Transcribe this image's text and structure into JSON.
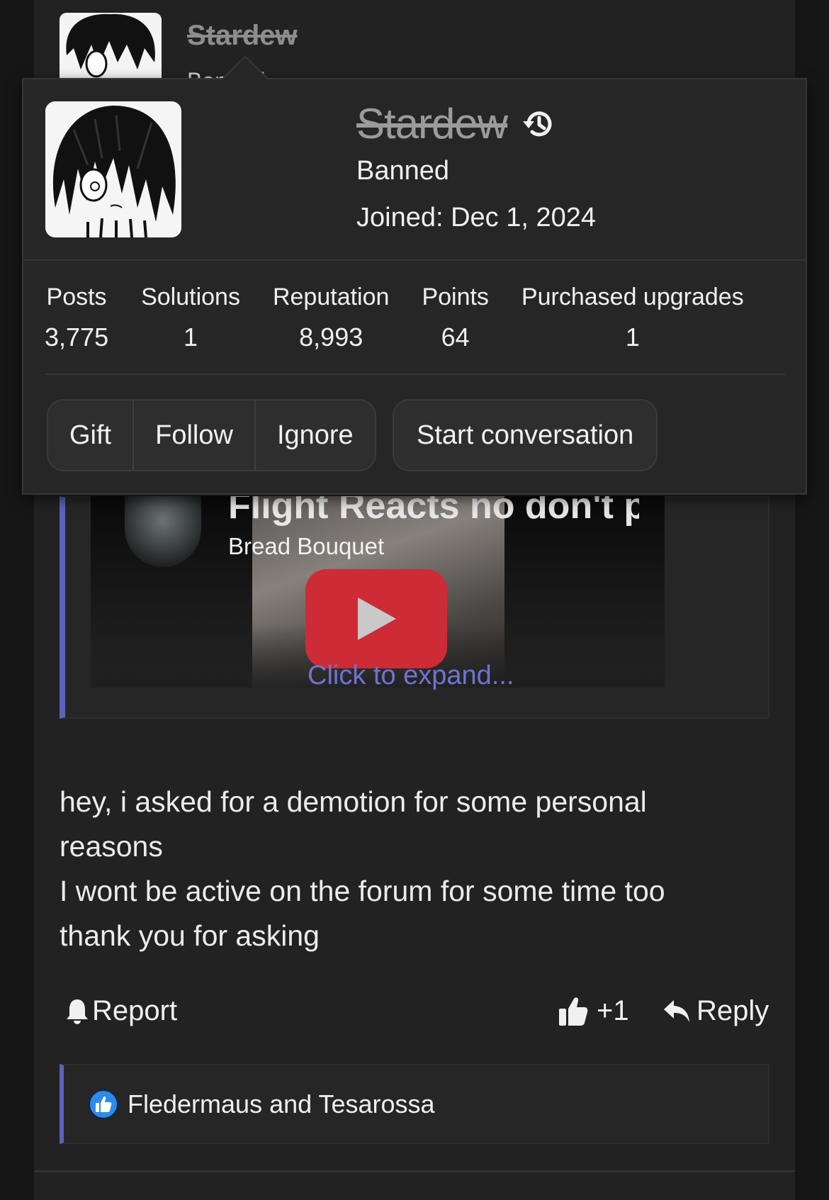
{
  "background_post": {
    "username": "Stardew",
    "subtitle": "Banned"
  },
  "member_tooltip": {
    "username": "Stardew",
    "user_title": "Banned",
    "joined": "Joined: Dec 1, 2024",
    "stats": [
      {
        "label": "Posts",
        "value": "3,775"
      },
      {
        "label": "Solutions",
        "value": "1"
      },
      {
        "label": "Reputation",
        "value": "8,993"
      },
      {
        "label": "Points",
        "value": "64"
      },
      {
        "label": "Purchased upgrades",
        "value": "1"
      }
    ],
    "buttons": {
      "gift": "Gift",
      "follow": "Follow",
      "ignore": "Ignore",
      "start_conversation": "Start conversation"
    }
  },
  "quote": {
    "video_title": "Flight Reacts no don't p",
    "video_channel": "Bread Bouquet",
    "expand_link": "Click to expand..."
  },
  "post": {
    "lines": [
      "hey, i asked for a demotion for some personal",
      "reasons",
      "I wont be active on the forum for some time too",
      "thank you for asking"
    ]
  },
  "actions": {
    "report": "Report",
    "like_count": "+1",
    "reply": "Reply"
  },
  "reactions": {
    "text": "Fledermaus and Tesarossa"
  },
  "colors": {
    "accent": "#5d63b8",
    "link": "#6e74d1",
    "like_badge": "#2d8ae8",
    "youtube_red": "#cd2b35"
  }
}
